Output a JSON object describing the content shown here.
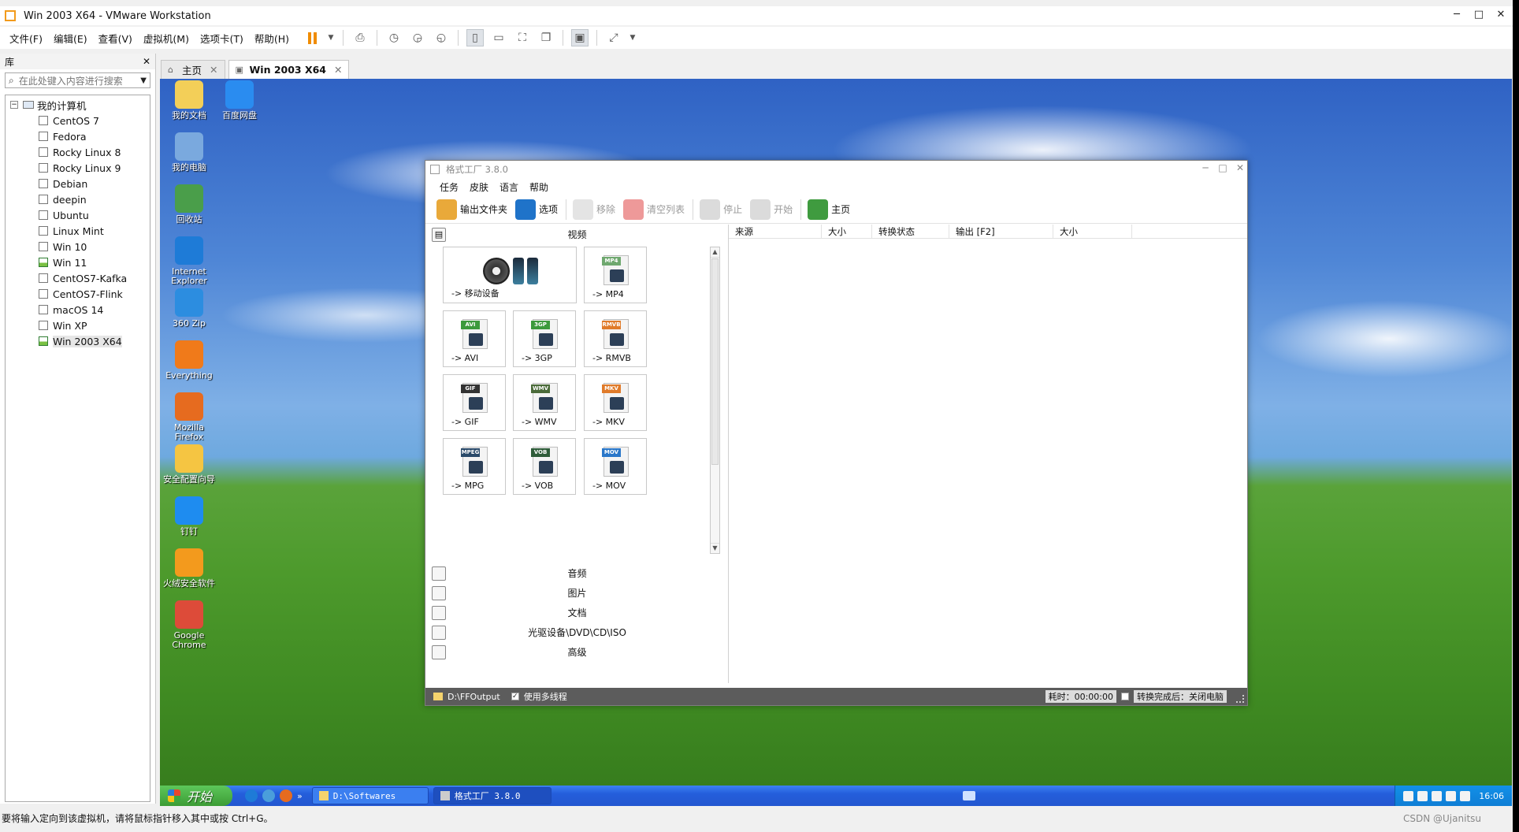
{
  "host": {
    "window_title": "Win 2003 X64 - VMware Workstation",
    "window_controls": [
      "─",
      "□",
      "✕"
    ],
    "menus": [
      "文件(F)",
      "编辑(E)",
      "查看(V)",
      "虚拟机(M)",
      "选项卡(T)",
      "帮助(H)"
    ],
    "library": {
      "title": "库",
      "close": "✕",
      "search_placeholder": "在此处键入内容进行搜索",
      "root": "我的计算机",
      "items": [
        "CentOS 7",
        "Fedora",
        "Rocky Linux 8",
        "Rocky Linux 9",
        "Debian",
        "deepin",
        "Ubuntu",
        "Linux Mint",
        "Win 10",
        "Win 11",
        "CentOS7-Kafka",
        "CentOS7-Flink",
        "macOS 14",
        "Win XP",
        "Win 2003 X64"
      ],
      "selected": "Win 2003 X64"
    },
    "tabs": [
      {
        "label": "主页",
        "close": "✕"
      },
      {
        "label": "Win 2003 X64",
        "close": "✕"
      }
    ],
    "statusbar": "要将输入定向到该虚拟机，请将鼠标指针移入其中或按 Ctrl+G。",
    "watermark": "CSDN @Uj​anitsu"
  },
  "desktop": {
    "icons": [
      {
        "label": "我的文档",
        "icon": "documents-icon",
        "color": "#f3cf58"
      },
      {
        "label": "百度网盘",
        "icon": "baidu-netdisk-icon",
        "color": "#2a8cf0"
      },
      {
        "label": "我的电脑",
        "icon": "my-computer-icon",
        "color": "#7aa9de"
      },
      {
        "label": "回收站",
        "icon": "recycle-bin-icon",
        "color": "#4a9e4a"
      },
      {
        "label": "Internet Explorer",
        "icon": "ie-icon",
        "color": "#1e7bd7"
      },
      {
        "label": "360 Zip",
        "icon": "zip-icon",
        "color": "#2c8de0"
      },
      {
        "label": "Everything",
        "icon": "everything-icon",
        "color": "#f07a1a"
      },
      {
        "label": "Mozilla Firefox",
        "icon": "firefox-icon",
        "color": "#e66b1f"
      },
      {
        "label": "安全配置向导",
        "icon": "security-wizard-icon",
        "color": "#f5c542"
      },
      {
        "label": "钉钉",
        "icon": "dingtalk-icon",
        "color": "#1e8cf0"
      },
      {
        "label": "火绒安全软件",
        "icon": "huorong-icon",
        "color": "#f39a1d"
      },
      {
        "label": "Google Chrome",
        "icon": "chrome-icon",
        "color": "#dd4b39"
      }
    ],
    "taskbar": {
      "start": "开始",
      "tasks": [
        "D:\\Softwares",
        "格式工厂 3.8.0"
      ],
      "clock": "16:06"
    }
  },
  "app": {
    "title": "格式工厂 3.8.0",
    "menus": [
      "任务",
      "皮肤",
      "语言",
      "帮助"
    ],
    "toolbar": [
      {
        "label": "输出文件夹",
        "icon": "folder-icon",
        "enabled": true,
        "color": "#e9a93a"
      },
      {
        "label": "选项",
        "icon": "options-icon",
        "enabled": true,
        "color": "#1f73c9"
      },
      {
        "label": "移除",
        "icon": "remove-icon",
        "enabled": false,
        "color": "#c9c9c9"
      },
      {
        "label": "清空列表",
        "icon": "clear-list-icon",
        "enabled": false,
        "color": "#d33"
      },
      {
        "label": "停止",
        "icon": "stop-icon",
        "enabled": false,
        "color": "#b8b8b8"
      },
      {
        "label": "开始",
        "icon": "start-icon",
        "enabled": false,
        "color": "#b8b8b8"
      },
      {
        "label": "主页",
        "icon": "home-globe-icon",
        "enabled": true,
        "color": "#3f9b3f"
      }
    ],
    "categories": {
      "video": "视频",
      "lower": [
        {
          "label": "音频",
          "icon": "music-icon"
        },
        {
          "label": "图片",
          "icon": "picture-icon"
        },
        {
          "label": "文档",
          "icon": "document-icon"
        },
        {
          "label": "光驱设备\\DVD\\CD\\ISO",
          "icon": "optical-drive-icon"
        },
        {
          "label": "高级",
          "icon": "advanced-icon"
        }
      ]
    },
    "tiles": [
      {
        "label": "-> 移动设备",
        "badge": "",
        "badge_color": "#999"
      },
      {
        "label": "-> MP4",
        "badge": "MP4",
        "badge_color": "#6fa86f"
      },
      {
        "label": "-> AVI",
        "badge": "AVI",
        "badge_color": "#3c9a3c"
      },
      {
        "label": "-> 3GP",
        "badge": "3GP",
        "badge_color": "#3c9a3c"
      },
      {
        "label": "-> RMVB",
        "badge": "RMVB",
        "badge_color": "#e07b2a"
      },
      {
        "label": "-> GIF",
        "badge": "GIF",
        "badge_color": "#333"
      },
      {
        "label": "-> WMV",
        "badge": "WMV",
        "badge_color": "#4b6b3a"
      },
      {
        "label": "-> MKV",
        "badge": "MKV",
        "badge_color": "#e07b2a"
      },
      {
        "label": "-> MPG",
        "badge": "MPEG",
        "badge_color": "#2a4a6a"
      },
      {
        "label": "-> VOB",
        "badge": "VOB",
        "badge_color": "#2f5d3a"
      },
      {
        "label": "-> MOV",
        "badge": "MOV",
        "badge_color": "#2a77c9"
      }
    ],
    "columns": [
      "来源",
      "大小",
      "转换状态",
      "输出 [F2]",
      "大小"
    ],
    "status": {
      "output_path": "D:\\FFOutput",
      "multithread_label": "使用多线程",
      "multithread_checked": true,
      "elapsed_label": "耗时：00:00:00",
      "after_done_label": "转换完成后：关闭电脑",
      "after_done_checked": false
    }
  }
}
